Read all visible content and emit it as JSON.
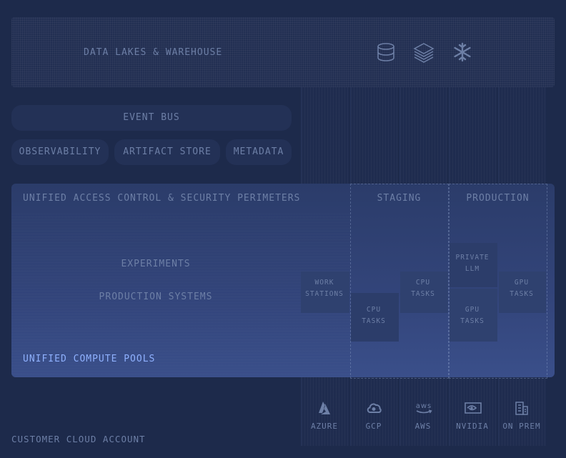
{
  "warehouse": {
    "label": "DATA LAKES & WAREHOUSE",
    "icons": [
      "database-icon",
      "layers-icon",
      "snowflake-icon"
    ]
  },
  "services": {
    "event_bus": "EVENT BUS",
    "observability": "OBSERVABILITY",
    "artifact_store": "ARTIFACT STORE",
    "metadata": "METADATA"
  },
  "access": {
    "label": "UNIFIED ACCESS CONTROL & SECURITY PERIMETERS",
    "staging": "STAGING",
    "production": "PRODUCTION"
  },
  "workloads": {
    "experiments": "EXPERIMENTS",
    "production_systems": "PRODUCTION SYSTEMS",
    "work_stations_1": "WORK",
    "work_stations_2": "STATIONS",
    "cpu_tasks_a_1": "CPU",
    "cpu_tasks_a_2": "TASKS",
    "cpu_tasks_b_1": "CPU",
    "cpu_tasks_b_2": "TASKS",
    "private_llm_1": "PRIVATE",
    "private_llm_2": "LLM",
    "gpu_tasks_a_1": "GPU",
    "gpu_tasks_a_2": "TASKS",
    "gpu_tasks_b_1": "GPU",
    "gpu_tasks_b_2": "TASKS"
  },
  "compute": {
    "label": "UNIFIED COMPUTE POOLS"
  },
  "providers": [
    {
      "label": "AZURE",
      "icon": "azure-icon"
    },
    {
      "label": "GCP",
      "icon": "gcp-cloud-icon"
    },
    {
      "label": "AWS",
      "icon": "aws-icon"
    },
    {
      "label": "NVIDIA",
      "icon": "nvidia-icon"
    },
    {
      "label": "ON PREM",
      "icon": "building-icon"
    }
  ],
  "customer": {
    "label": "CUSTOMER CLOUD ACCOUNT"
  },
  "colors": {
    "accent_blue": "#8fb1ff",
    "muted_text": "#6d7fa6",
    "background": "#1d2a4b"
  }
}
